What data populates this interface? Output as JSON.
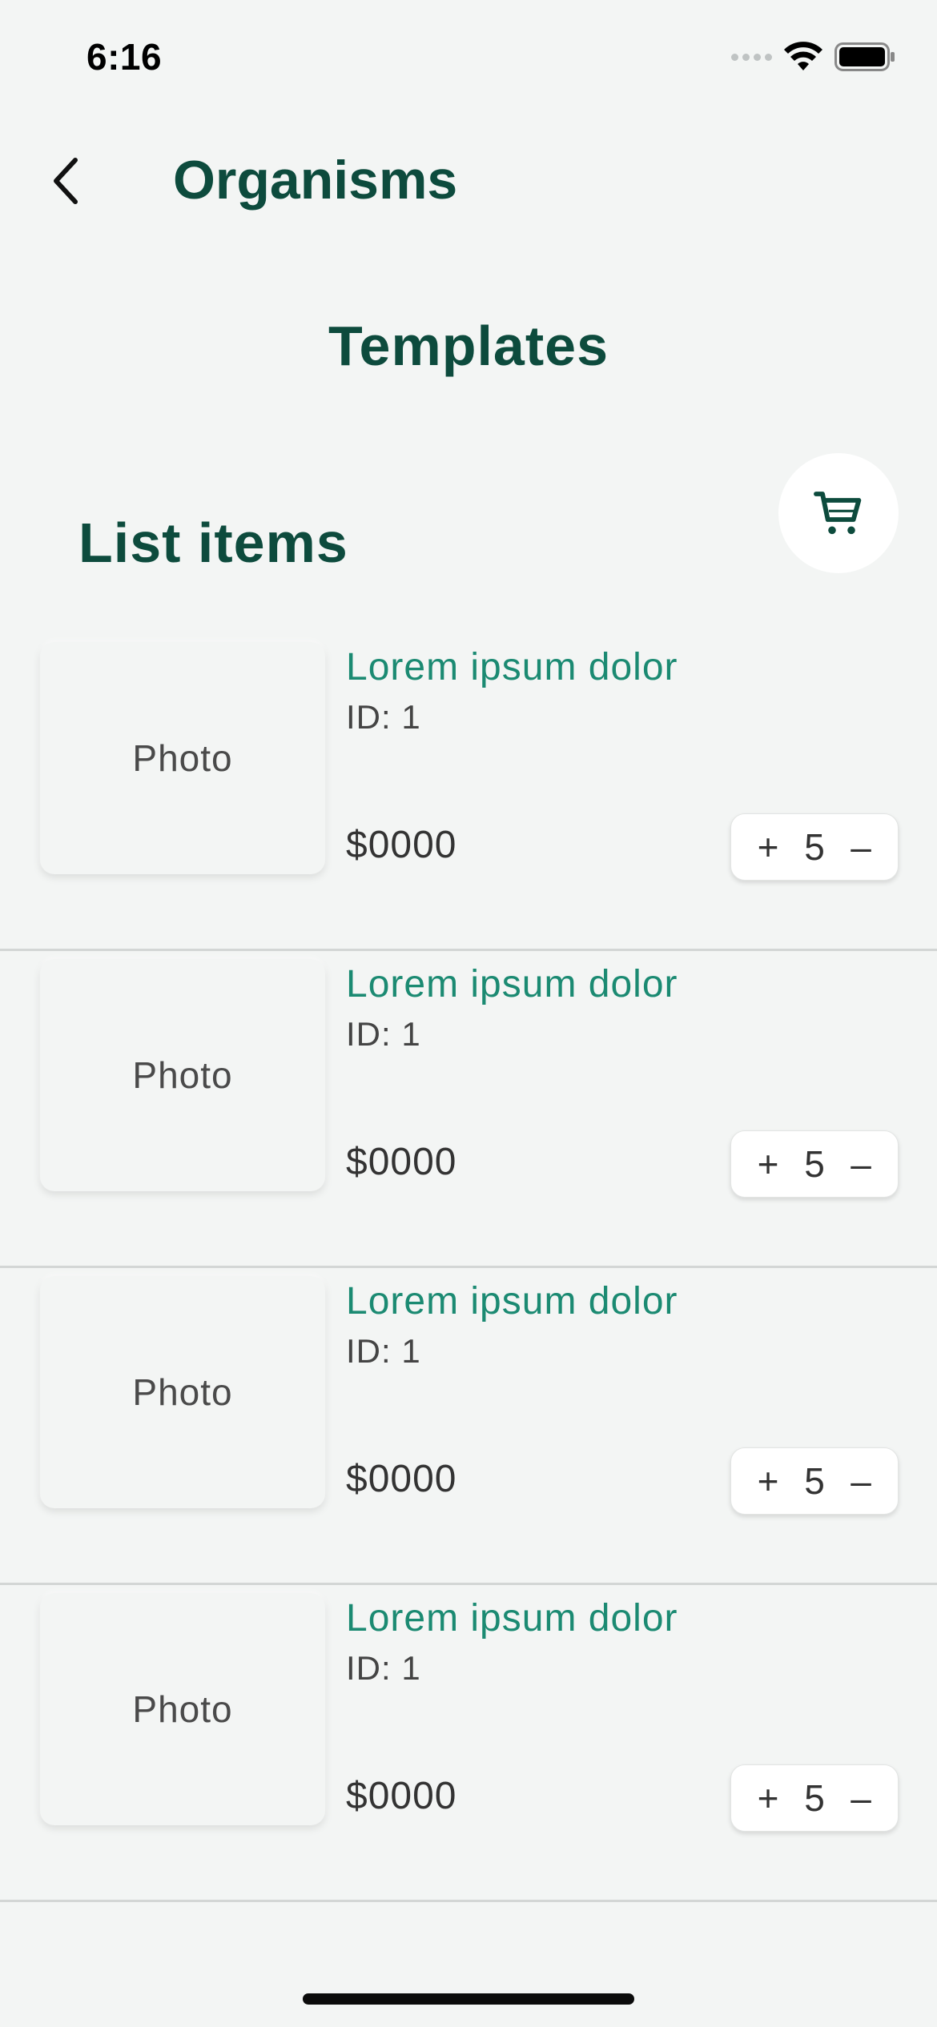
{
  "status_bar": {
    "time": "6:16",
    "icons": [
      "signal-icon",
      "wifi-icon",
      "battery-icon"
    ]
  },
  "nav": {
    "back_icon": "chevron-left-icon",
    "title": "Organisms"
  },
  "page_heading": "Templates",
  "section_heading": "List items",
  "cart_icon": "shopping-cart-icon",
  "colors": {
    "background": "#f3f5f4",
    "heading": "#0d4b3d",
    "accent": "#1b8a72"
  },
  "items": [
    {
      "photo_label": "Photo",
      "title": "Lorem ipsum dolor",
      "id": "ID: 1",
      "price": "$0000",
      "plus": "+",
      "quantity": "5",
      "minus": "–"
    },
    {
      "photo_label": "Photo",
      "title": "Lorem ipsum dolor",
      "id": "ID: 1",
      "price": "$0000",
      "plus": "+",
      "quantity": "5",
      "minus": "–"
    },
    {
      "photo_label": "Photo",
      "title": "Lorem ipsum dolor",
      "id": "ID: 1",
      "price": "$0000",
      "plus": "+",
      "quantity": "5",
      "minus": "–"
    },
    {
      "photo_label": "Photo",
      "title": "Lorem ipsum dolor",
      "id": "ID: 1",
      "price": "$0000",
      "plus": "+",
      "quantity": "5",
      "minus": "–"
    }
  ]
}
